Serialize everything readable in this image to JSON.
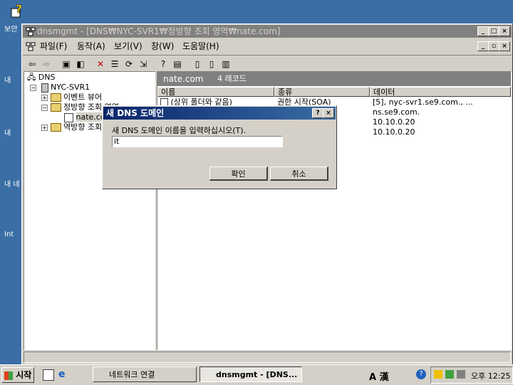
{
  "desktop": {
    "icons": [
      {
        "label": "보안",
        "icon": "help-icon"
      },
      {
        "label": "내",
        "icon": "documents-icon"
      },
      {
        "label": "내 ",
        "icon": "computer-icon"
      },
      {
        "label": "내 네",
        "icon": "network-icon"
      },
      {
        "label": "Int",
        "icon": "ie-icon"
      }
    ]
  },
  "window": {
    "title": "dnsmgmt - [DNS₩NYC-SVR1₩정방향 조회 영역₩nate.com]",
    "menu": [
      "파일(F)",
      "동작(A)",
      "보기(V)",
      "창(W)",
      "도움말(H)"
    ]
  },
  "tree": {
    "root": "DNS",
    "server": "NYC-SVR1",
    "items": [
      "이벤트 뷰어",
      "정방향 조회 영역",
      "nate.com",
      "역방향 조회 영역"
    ]
  },
  "detail": {
    "zone": "nate.com",
    "count": "4 레코드",
    "columns": [
      "이름",
      "종류",
      "데이터"
    ],
    "rows": [
      {
        "name": "(상위 폴더와 같음)",
        "type": "권한 시작(SOA)",
        "data": "[5], nyc-svr1.se9.com., ..."
      },
      {
        "name": "",
        "type": "",
        "data": "ns.se9.com."
      },
      {
        "name": "",
        "type": "",
        "data": "10.10.0.20"
      },
      {
        "name": "",
        "type": "",
        "data": "10.10.0.20"
      }
    ]
  },
  "dialog": {
    "title": "새 DNS 도메인",
    "prompt": "새 DNS 도메인 이름을 입력하십시오(T).",
    "value": "it",
    "ok": "확인",
    "cancel": "취소"
  },
  "taskbar": {
    "start": "시작",
    "tasks": [
      "네트워크 연결",
      "dnsmgmt - [DNS..."
    ],
    "tray_lang": "A 漢",
    "time": "오후 12:25"
  }
}
